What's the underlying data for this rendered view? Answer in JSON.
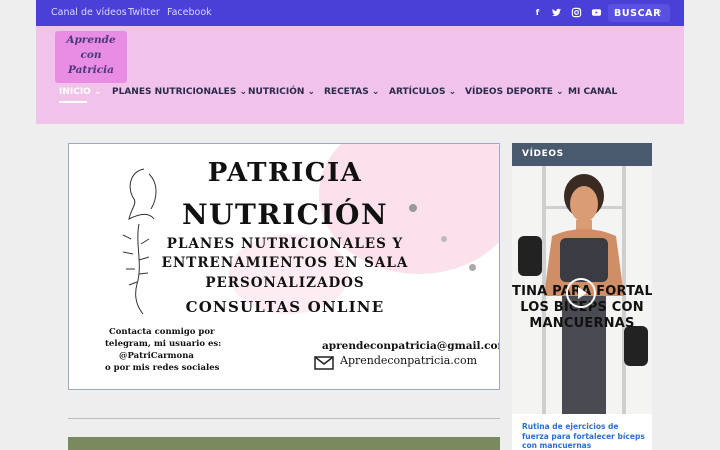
{
  "topbar": {
    "links": [
      "Canal de vídeos",
      "Twitter",
      "Facebook"
    ],
    "social_icons": [
      "facebook-icon",
      "twitter-icon",
      "instagram-icon",
      "youtube-icon"
    ],
    "search_label": "BUSCAR"
  },
  "logo": {
    "lines": [
      "Aprende",
      "con",
      "Patricia"
    ]
  },
  "nav": [
    {
      "label": "INICIO",
      "has_dropdown": true,
      "active": true
    },
    {
      "label": "PLANES NUTRICIONALES",
      "has_dropdown": true
    },
    {
      "label": "NUTRICIÓN",
      "has_dropdown": true
    },
    {
      "label": "RECETAS",
      "has_dropdown": true
    },
    {
      "label": "ARTÍCULOS",
      "has_dropdown": true
    },
    {
      "label": "VÍDEOS DEPORTE",
      "has_dropdown": true
    },
    {
      "label": "MI CANAL",
      "has_dropdown": false
    }
  ],
  "banner": {
    "title1": "PATRICIA",
    "title2": "NUTRICIÓN",
    "line1": "PLANES NUTRICIONALES Y",
    "line2": "ENTRENAMIENTOS EN SALA",
    "line3": "PERSONALIZADOS",
    "line4": "CONSULTAS ONLINE",
    "contact": [
      "Contacta conmigo por",
      "telegram, mi usuario es:",
      "@PatriCarmona",
      "o por mis redes sociales"
    ],
    "email": "aprendeconpatricia@gmail.com",
    "site": "Aprendeconpatricia.com"
  },
  "sidebar": {
    "title": "VÍDEOS",
    "video_overlay": [
      "TINA PARA FORTALEC",
      "LOS BÍCEPS CON",
      "MANCUERNAS"
    ],
    "caption": "Rutina de ejercicios de fuerza para fortalecer bíceps con mancuernas"
  },
  "colors": {
    "topbar": "#4a3fd6",
    "header": "#f1c2ea",
    "link": "#2a6fd8"
  }
}
